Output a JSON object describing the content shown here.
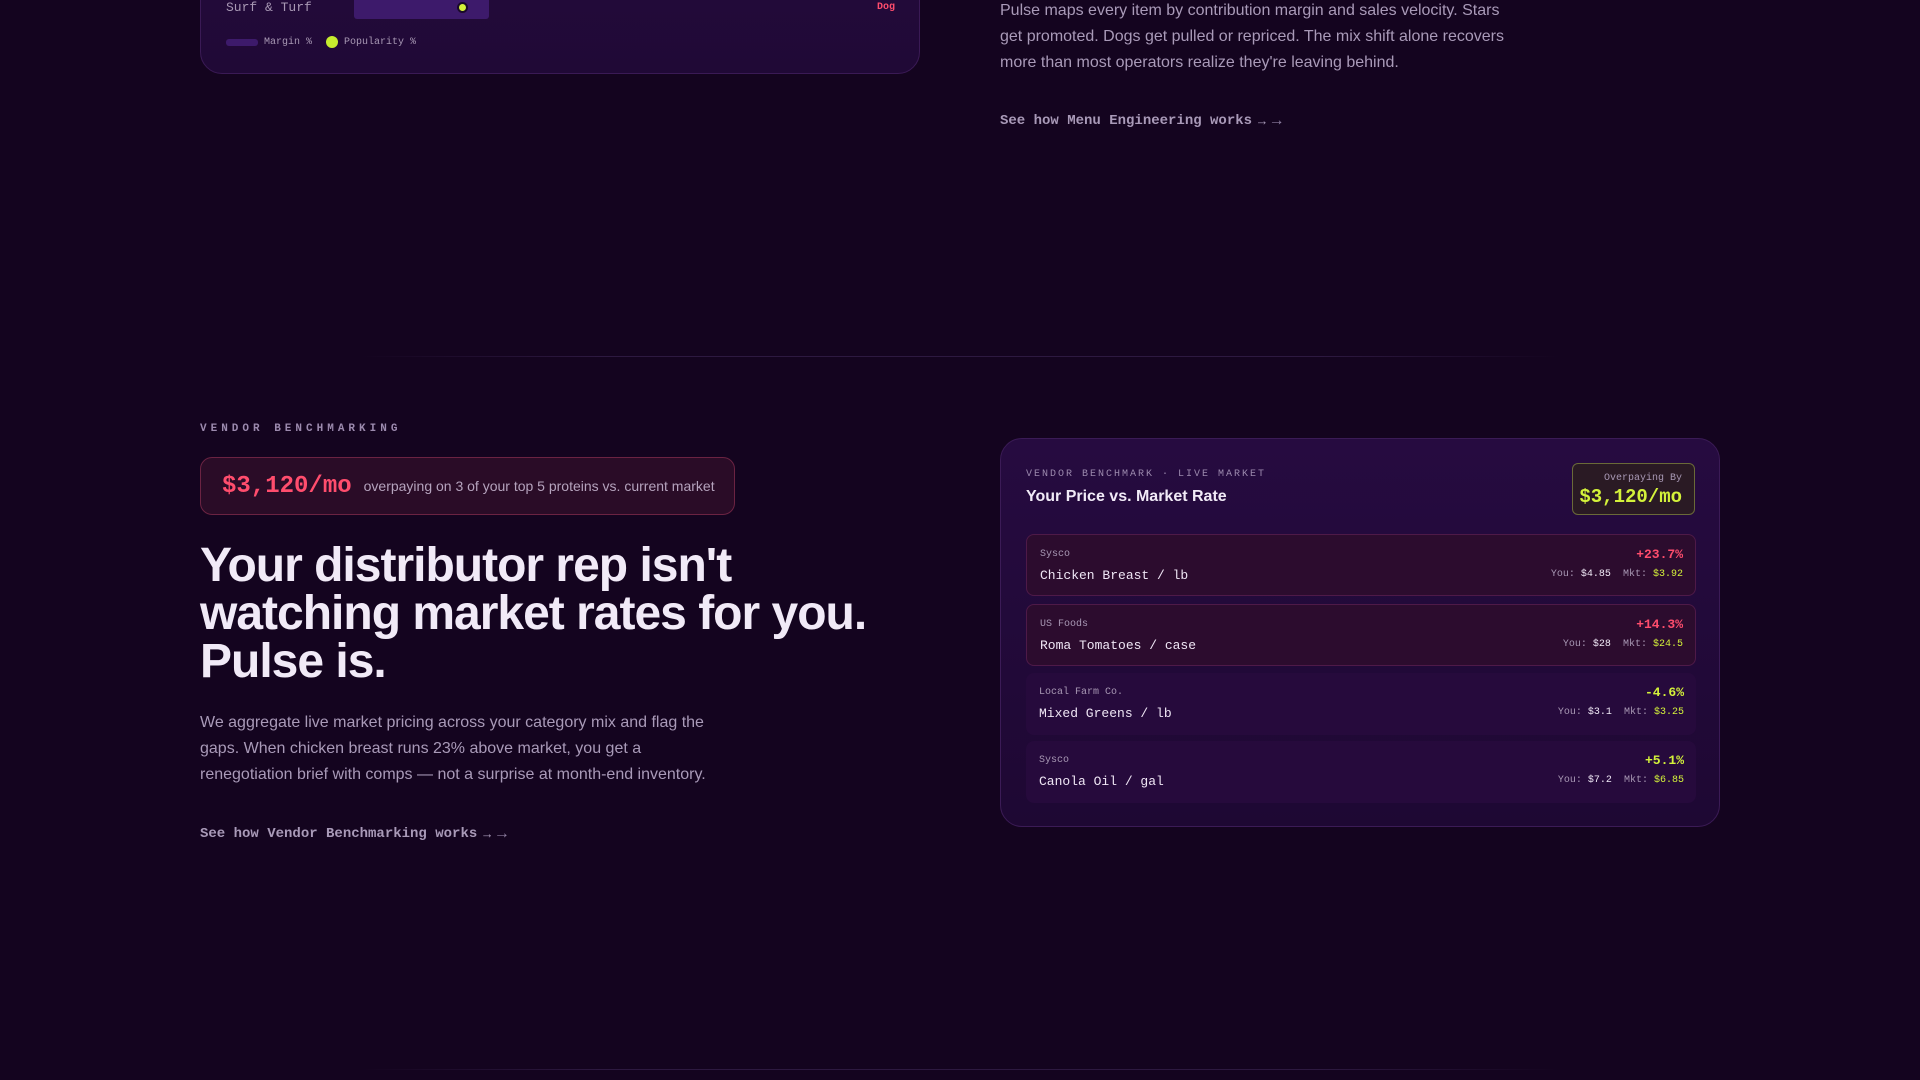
{
  "menu_chart": {
    "row_label": "Surf & Turf",
    "row_tag": "Dog",
    "legend": {
      "margin": "Margin %",
      "popularity": "Popularity %"
    }
  },
  "menu_engineering": {
    "description": "Pulse maps every item by contribution margin and sales velocity. Stars get promoted. Dogs get pulled or repriced. The mix shift alone recovers more than most operators realize they're leaving behind.",
    "cta": "See how Menu Engineering works",
    "cta_arrow": "→",
    "cta_icon": "→"
  },
  "vendor": {
    "eyebrow": "VENDOR BENCHMARKING",
    "pill_value": "$3,120/mo",
    "pill_text": "overpaying on 3 of your top 5 proteins vs. current market",
    "headline": "Your distributor rep isn't watching market rates for you. Pulse is.",
    "body": "We aggregate live market pricing across your category mix and flag the gaps. When chicken breast runs 23% above market, you get a renegotiation brief with comps — not a surprise at month-end inventory.",
    "cta": "See how Vendor Benchmarking works",
    "cta_arrow": "→",
    "cta_icon": "→"
  },
  "card": {
    "eyebrow": "VENDOR BENCHMARK · LIVE MARKET",
    "title": "Your Price vs. Market Rate",
    "badge_label": "Overpaying By",
    "badge_value": "$3,120/mo",
    "rows": [
      {
        "vendor": "Sysco",
        "item": "Chicken Breast / lb",
        "pct": "+23.7%",
        "you_label": "You:",
        "you": "$4.85",
        "mkt_label": "Mkt:",
        "mkt": "$3.92"
      },
      {
        "vendor": "US Foods",
        "item": "Roma Tomatoes / case",
        "pct": "+14.3%",
        "you_label": "You:",
        "you": "$28",
        "mkt_label": "Mkt:",
        "mkt": "$24.5"
      },
      {
        "vendor": "Local Farm Co.",
        "item": "Mixed Greens / lb",
        "pct": "-4.6%",
        "you_label": "You:",
        "you": "$3.1",
        "mkt_label": "Mkt:",
        "mkt": "$3.25"
      },
      {
        "vendor": "Sysco",
        "item": "Canola Oil / gal",
        "pct": "+5.1%",
        "you_label": "You:",
        "you": "$7.2",
        "mkt_label": "Mkt:",
        "mkt": "$6.85"
      }
    ]
  },
  "colors": {
    "background": "#14041f",
    "alert": "#ff4d6d",
    "accent": "#d4f23a"
  }
}
